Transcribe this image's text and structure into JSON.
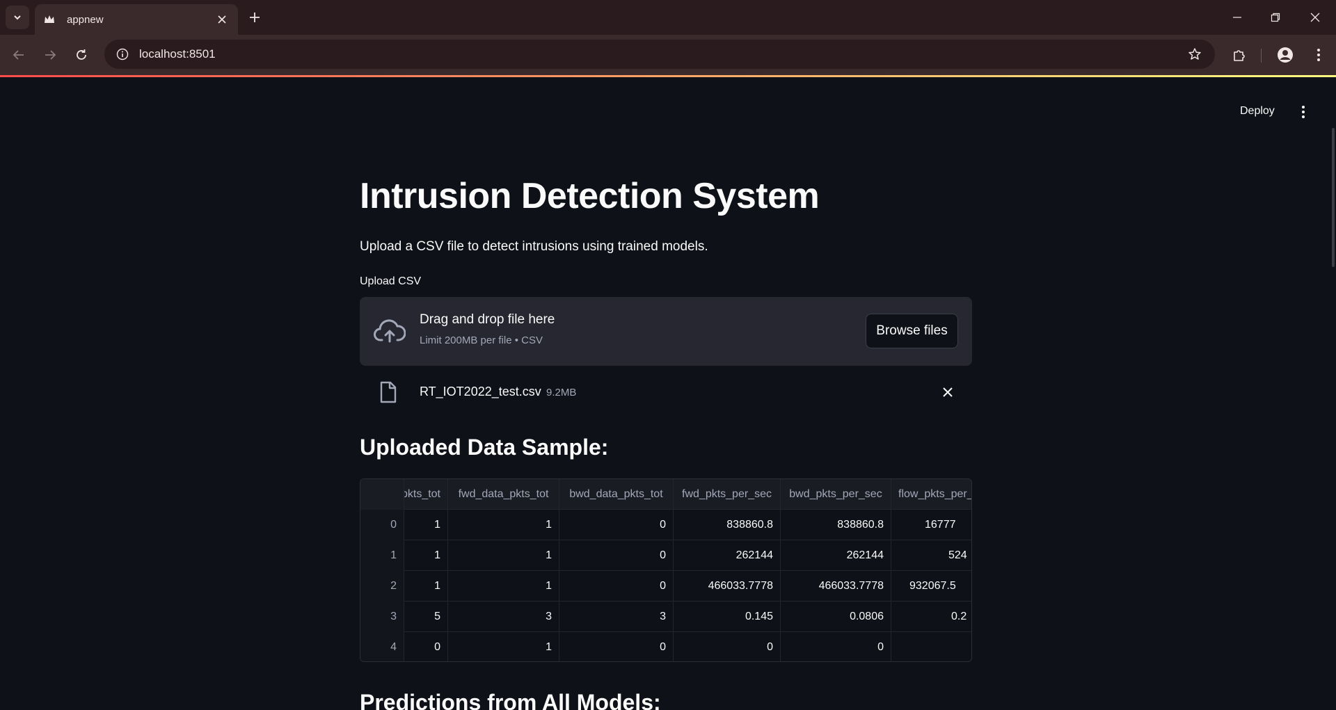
{
  "browser": {
    "tab_title": "appnew",
    "url": "localhost:8501"
  },
  "app": {
    "deploy_label": "Deploy",
    "title": "Intrusion Detection System",
    "subtitle": "Upload a CSV file to detect intrusions using trained models.",
    "upload_label": "Upload CSV",
    "dropzone": {
      "title": "Drag and drop file here",
      "limit": "Limit 200MB per file • CSV",
      "browse_label": "Browse files"
    },
    "file": {
      "name": "RT_IOT2022_test.csv",
      "size": "9.2MB"
    },
    "sample_heading": "Uploaded Data Sample:",
    "predictions_heading": "Predictions from All Models:",
    "table": {
      "columns": [
        "pkts_tot",
        "fwd_data_pkts_tot",
        "bwd_data_pkts_tot",
        "fwd_pkts_per_sec",
        "bwd_pkts_per_sec",
        "flow_pkts_per_"
      ],
      "rows": [
        {
          "index": "0",
          "cells": [
            "1",
            "1",
            "0",
            "838860.8",
            "838860.8",
            "16777"
          ]
        },
        {
          "index": "1",
          "cells": [
            "1",
            "1",
            "0",
            "262144",
            "262144",
            "524"
          ]
        },
        {
          "index": "2",
          "cells": [
            "1",
            "1",
            "0",
            "466033.7778",
            "466033.7778",
            "932067.5"
          ]
        },
        {
          "index": "3",
          "cells": [
            "5",
            "3",
            "3",
            "0.145",
            "0.0806",
            "0.2"
          ]
        },
        {
          "index": "4",
          "cells": [
            "0",
            "1",
            "0",
            "0",
            "0",
            ""
          ]
        }
      ]
    }
  },
  "colors": {
    "background": "#0e1117",
    "dropzone": "#262730",
    "accent_gradient_start": "#ff4b4b",
    "accent_gradient_end": "#fffd80",
    "muted_text": "#a3a8b8"
  }
}
